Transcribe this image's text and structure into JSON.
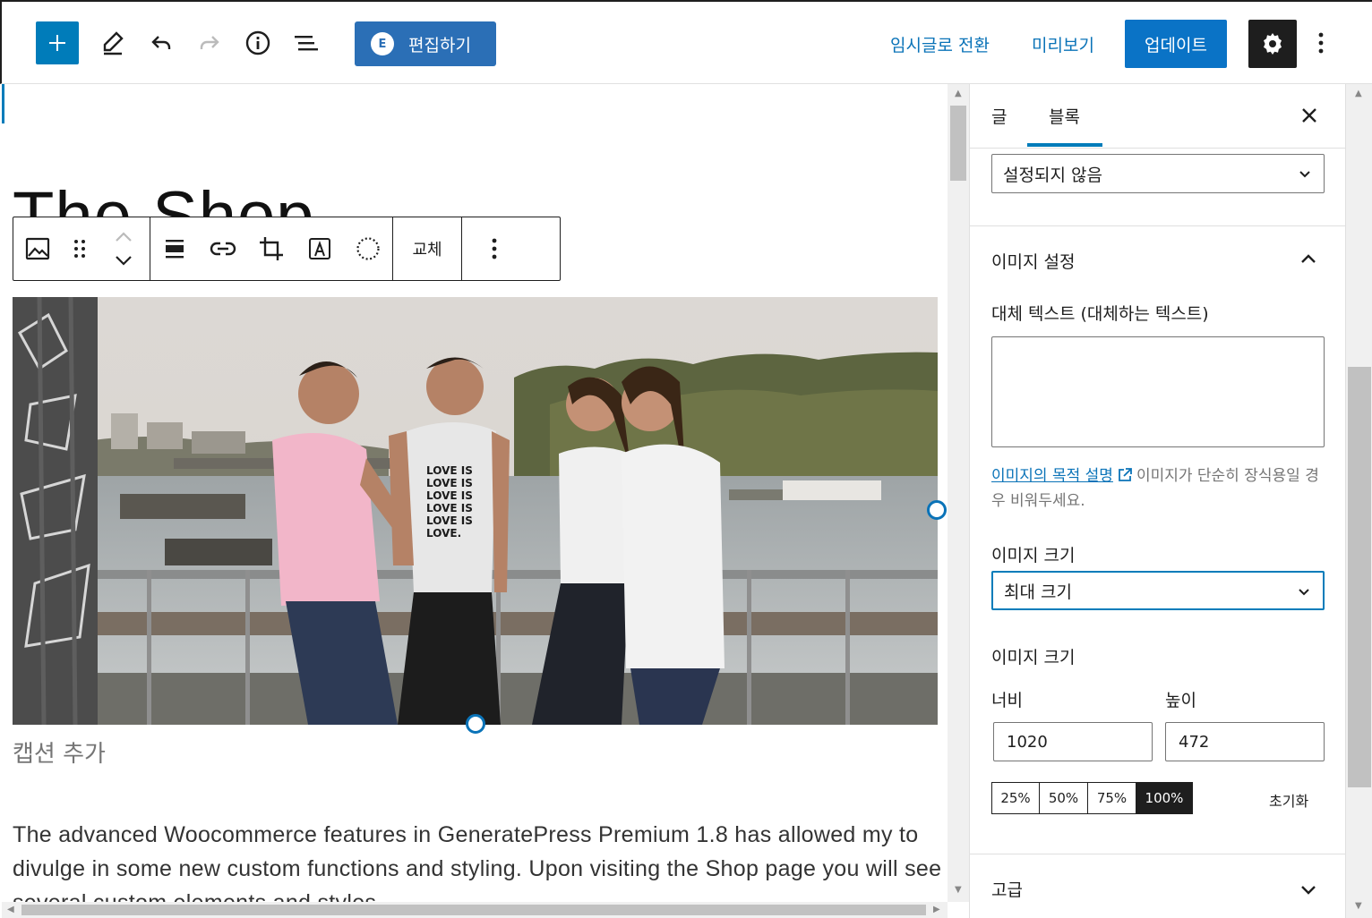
{
  "header": {
    "edit_button_label": "편집하기",
    "edit_button_logo": "E",
    "save_draft_label": "임시글로 전환",
    "preview_label": "미리보기",
    "update_label": "업데이트",
    "icons": [
      "plus-icon",
      "pencil-icon",
      "undo-icon",
      "redo-icon",
      "info-icon",
      "list-view-icon",
      "gear-icon",
      "more-vertical-icon"
    ]
  },
  "editor": {
    "post_title": "The Shop",
    "block_toolbar": {
      "replace_label": "교체",
      "icons": [
        "image-icon",
        "drag-handle-icon",
        "move-up-icon",
        "move-down-icon",
        "align-icon",
        "link-icon",
        "crop-icon",
        "text-overlay-icon",
        "duotone-icon",
        "more-vertical-icon"
      ]
    },
    "image": {
      "shirt_text": [
        "LOVE IS",
        "LOVE IS",
        "LOVE IS",
        "LOVE IS",
        "LOVE IS",
        "LOVE."
      ]
    },
    "caption_placeholder": "캡션 추가",
    "paragraph": "The advanced Woocommerce features in GeneratePress Premium 1.8 has allowed my to divulge in some new custom functions and styling. Upon visiting the Shop page you will see several custom elements and styles."
  },
  "sidebar": {
    "tabs": [
      {
        "label": "글",
        "active": false
      },
      {
        "label": "블록",
        "active": true
      }
    ],
    "link_select_value": "설정되지 않음",
    "image_settings_heading": "이미지 설정",
    "alt_text_label": "대체 텍스트 (대체하는 텍스트)",
    "alt_text_value": "",
    "help_link": "이미지의 목적 설명",
    "help_text": "이미지가 단순히 장식용일 경우 비워두세요.",
    "image_size_label": "이미지 크기",
    "image_size_value": "최대 크기",
    "image_dimensions_label": "이미지 크기",
    "width_label": "너비",
    "height_label": "높이",
    "width_value": "1020",
    "height_value": "472",
    "percent_options": [
      "25%",
      "50%",
      "75%",
      "100%"
    ],
    "percent_active": "100%",
    "reset_label": "초기화",
    "advanced_heading": "고급"
  },
  "colors": {
    "accent": "#007cba",
    "edit_button": "#2b6fb6",
    "link": "#0a73b8",
    "dark": "#1e1e1e"
  }
}
